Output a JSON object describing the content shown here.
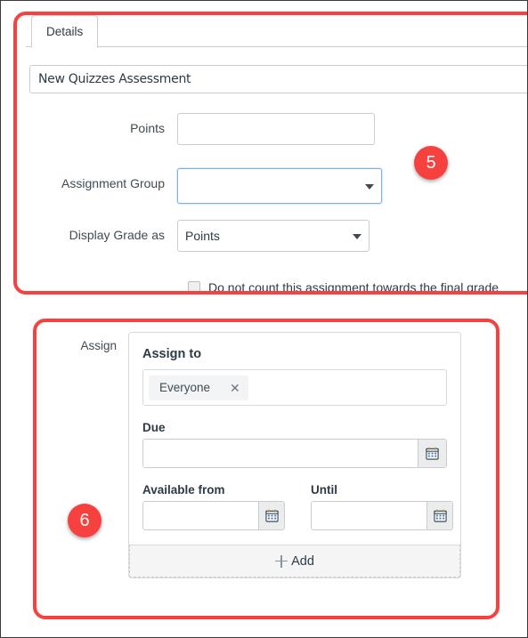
{
  "details": {
    "tab_label": "Details",
    "title_value": "New Quizzes Assessment",
    "title_placeholder": "",
    "fields": {
      "points_label": "Points",
      "points_value": "",
      "assignment_group_label": "Assignment Group",
      "assignment_group_value": "",
      "display_grade_label": "Display Grade as",
      "display_grade_value": "Points"
    },
    "checkbox_label": "Do not count this assignment towards the final grade",
    "checkbox_checked": false
  },
  "assign": {
    "section_label": "Assign",
    "card_heading": "Assign to",
    "tokens": [
      {
        "label": "Everyone",
        "remove_icon": "✕"
      }
    ],
    "due_label": "Due",
    "due_value": "",
    "available_from_label": "Available from",
    "available_from_value": "",
    "until_label": "Until",
    "until_value": "",
    "add_label": "Add"
  },
  "annotations": {
    "badges": [
      {
        "number": "5"
      },
      {
        "number": "6"
      }
    ],
    "accent_color": "#f7413f"
  }
}
